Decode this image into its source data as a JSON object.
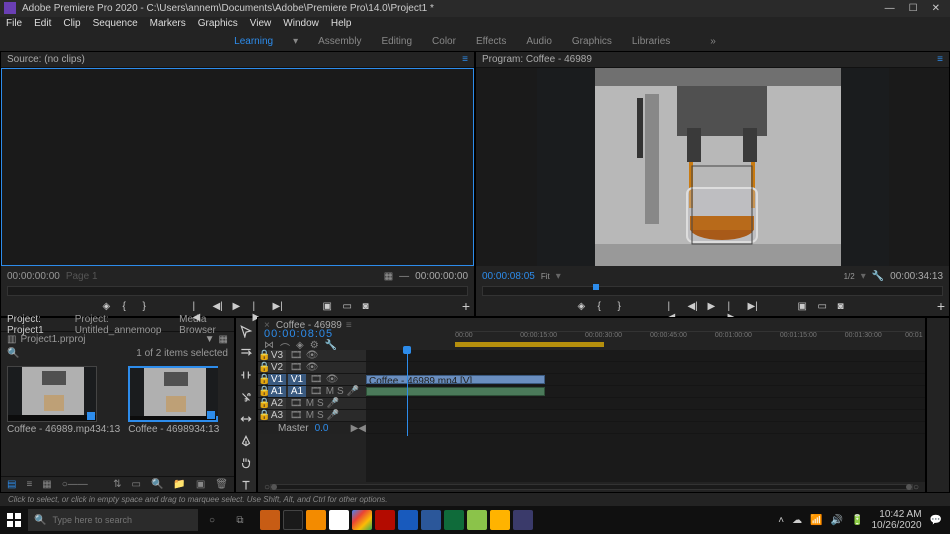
{
  "titlebar": {
    "title": "Adobe Premiere Pro 2020 - C:\\Users\\annem\\Documents\\Adobe\\Premiere Pro\\14.0\\Project1 *"
  },
  "menu": [
    "File",
    "Edit",
    "Clip",
    "Sequence",
    "Markers",
    "Graphics",
    "View",
    "Window",
    "Help"
  ],
  "workspaces": {
    "items": [
      "Learning",
      "Assembly",
      "Editing",
      "Color",
      "Effects",
      "Audio",
      "Graphics",
      "Libraries"
    ],
    "active": 0
  },
  "source": {
    "title": "Source: (no clips)",
    "time_cur": "00:00:00:00",
    "time_dur": "00:00:00:00",
    "page_label": "Page 1"
  },
  "program": {
    "title": "Program: Coffee - 46989",
    "time_cur": "00:00:08:05",
    "time_dur": "00:00:34:13",
    "fit": "Fit",
    "zoom": "1/2"
  },
  "project": {
    "tabs": [
      "Project: Project1",
      "Project: Untitled_annemoop",
      "Media Browser"
    ],
    "file": "Project1.prproj",
    "count": "1 of 2 items selected",
    "clips": [
      {
        "name": "Coffee - 46989.mp4",
        "dur": "34:13",
        "selected": false
      },
      {
        "name": "Coffee - 46989",
        "dur": "34:13",
        "selected": true
      }
    ]
  },
  "timeline": {
    "sequence": "Coffee - 46989",
    "time": "00:00:08:05",
    "ruler": [
      "00:00",
      "00:00:15:00",
      "00:00:30:00",
      "00:00:45:00",
      "00:01:00:00",
      "00:01:15:00",
      "00:01:30:00",
      "00:01"
    ],
    "clip_name": "Coffee - 46989.mp4 [V]",
    "tracks": {
      "v": [
        "V3",
        "V2",
        "V1"
      ],
      "a": [
        "A1",
        "A2",
        "A3"
      ],
      "master": "Master",
      "master_val": "0.0"
    }
  },
  "status": "Click to select, or click in empty space and drag to marquee select. Use Shift, Alt, and Ctrl for other options.",
  "taskbar": {
    "search_ph": "Type here to search",
    "time": "10:42 AM",
    "date": "10/26/2020"
  },
  "colors": {
    "accent": "#2d8ceb"
  }
}
